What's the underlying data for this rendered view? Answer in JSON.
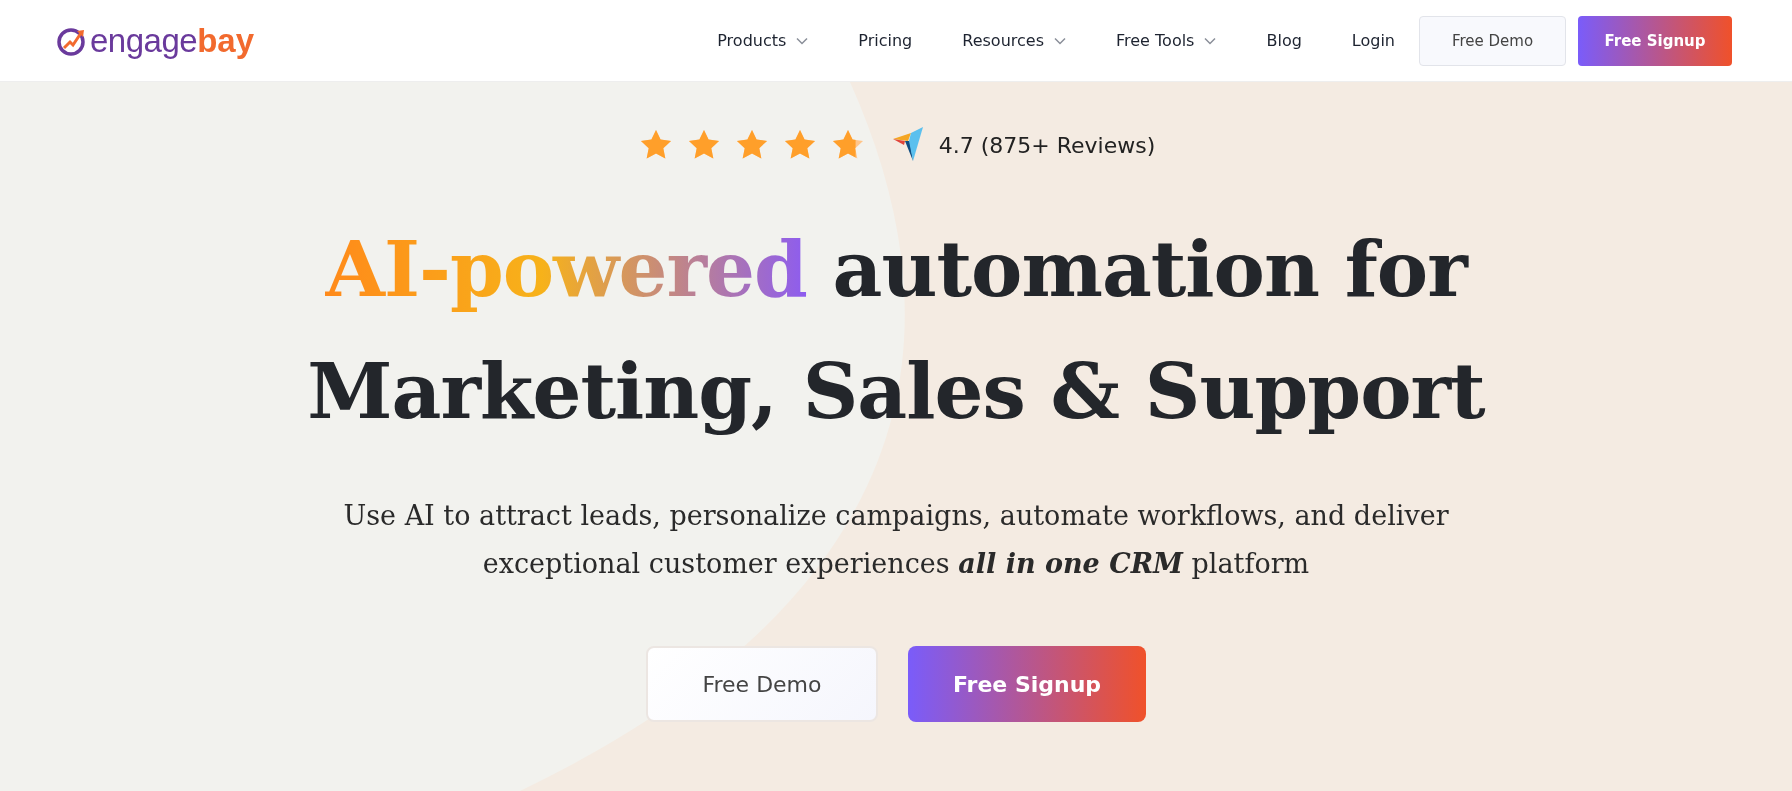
{
  "logo": {
    "first": "engage",
    "second": "bay"
  },
  "nav": [
    {
      "label": "Products",
      "has_menu": true
    },
    {
      "label": "Pricing",
      "has_menu": false
    },
    {
      "label": "Resources",
      "has_menu": true
    },
    {
      "label": "Free Tools",
      "has_menu": true
    },
    {
      "label": "Blog",
      "has_menu": false
    },
    {
      "label": "Login",
      "has_menu": false
    }
  ],
  "header_buttons": [
    {
      "label": "Free Demo",
      "kind": "secondary"
    },
    {
      "label": "Free Signup",
      "kind": "primary"
    }
  ],
  "rating": {
    "stars": 4.7,
    "text": "4.7 (875+ Reviews)"
  },
  "headline": {
    "highlight": "AI-powered",
    "rest": "automation for Marketing, Sales & Support"
  },
  "subtitle": "Use AI to attract leads, personalize campaigns, automate workflows, and deliver exceptional customer experiences **all in one CRM** platform",
  "cta_buttons": [
    {
      "label": "Free Demo",
      "kind": "secondary"
    },
    {
      "label": "Free Signup",
      "kind": "primary"
    }
  ]
}
